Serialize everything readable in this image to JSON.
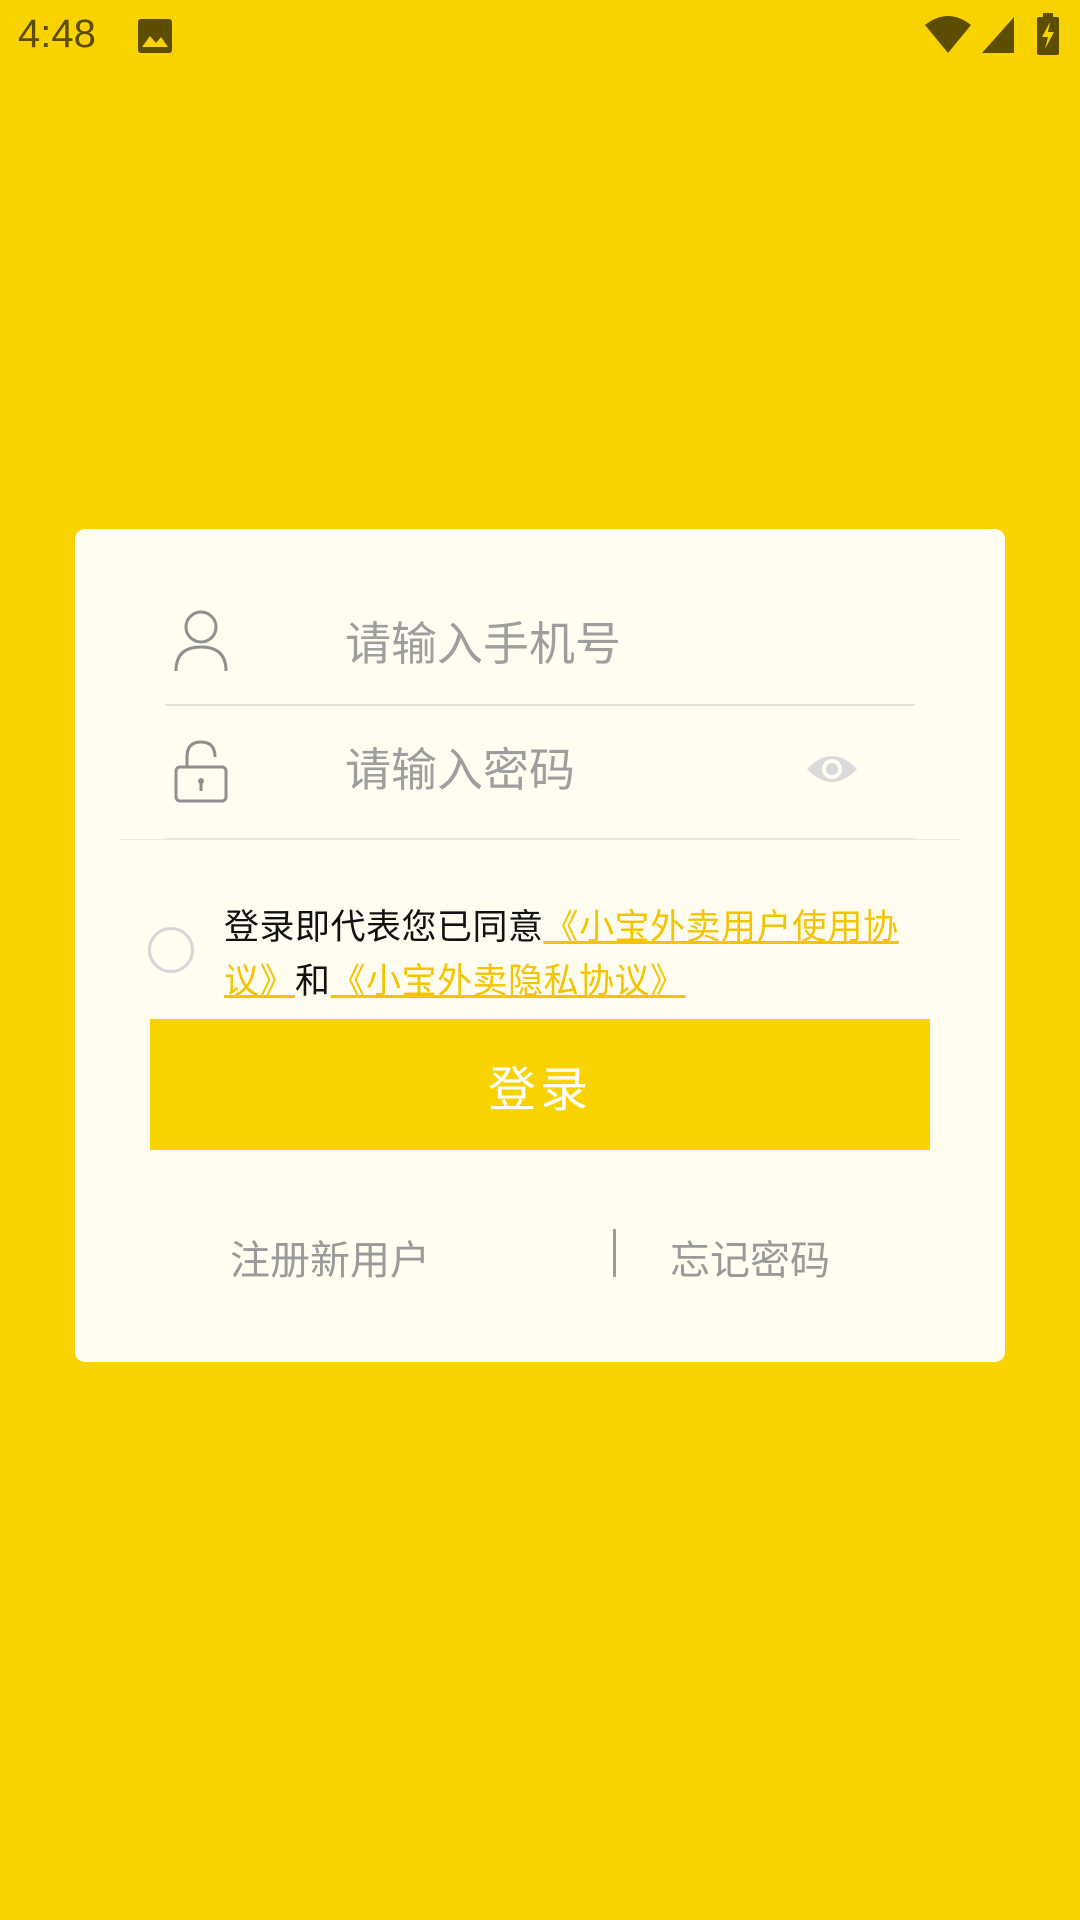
{
  "status_bar": {
    "time": "4:48",
    "icons": [
      "image-icon",
      "wifi-icon",
      "cell-signal-icon",
      "battery-charging-icon"
    ]
  },
  "login_form": {
    "phone_placeholder": "请输入手机号",
    "phone_value": "",
    "password_placeholder": "请输入密码",
    "password_value": "",
    "agreement": {
      "prefix": "登录即代表您已同意",
      "user_agreement_link": "《小宝外卖用户使用协议》",
      "conjunction": "和",
      "privacy_link": "《小宝外卖隐私协议》",
      "checked": false
    },
    "login_label": "登录",
    "register_label": "注册新用户",
    "forgot_label": "忘记密码"
  },
  "colors": {
    "background": "#F8D300",
    "card": "#FFFDF0",
    "link": "#F5C400",
    "secondary_text": "#9A9A9A"
  }
}
